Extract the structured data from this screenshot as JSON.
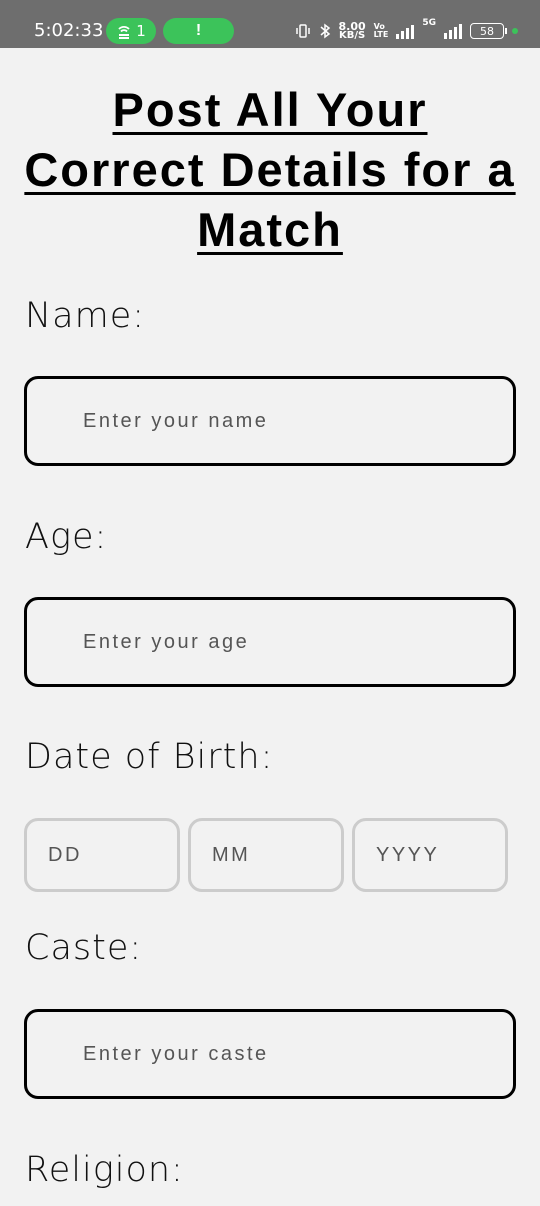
{
  "status_bar": {
    "time": "5:02:33",
    "hotspot_count": "1",
    "alert_glyph": "!",
    "speed_value": "8.00",
    "speed_unit": "KB/S",
    "volte_top": "Vo",
    "volte_bottom": "LTE",
    "network_type": "5G",
    "battery": "58",
    "icons": [
      "hotspot-icon",
      "alert-icon",
      "vibrate-icon",
      "bluetooth-icon",
      "signal-icon",
      "battery-icon"
    ]
  },
  "form": {
    "title": "Post All Your Correct Details for a Match",
    "name_label": "Name:",
    "name_placeholder": "Enter your name",
    "age_label": "Age:",
    "age_placeholder": "Enter your age",
    "dob_label": "Date of Birth:",
    "dob_day_placeholder": "DD",
    "dob_month_placeholder": "MM",
    "dob_year_placeholder": "YYYY",
    "caste_label": "Caste:",
    "caste_placeholder": "Enter your caste",
    "religion_label": "Religion:"
  },
  "colors": {
    "background": "#f2f2f2",
    "status_bar": "#6e6e6e",
    "accent_green": "#3cc35a",
    "field_border": "#000000",
    "dob_border": "#cccccc"
  }
}
